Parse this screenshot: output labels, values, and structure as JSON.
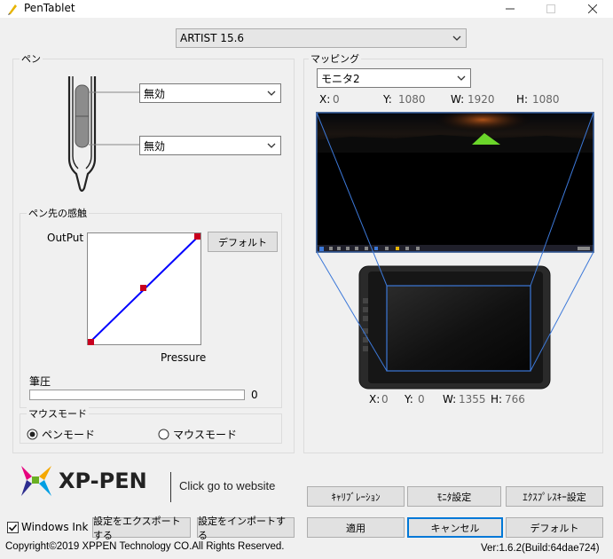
{
  "window": {
    "title": "PenTablet"
  },
  "device_select": {
    "value": "ARTIST 15.6"
  },
  "pen": {
    "group_label": "ペン",
    "upper_button": "無効",
    "lower_button": "無効"
  },
  "pressure_group": {
    "label": "ペン先の感触",
    "output_label": "OutPut",
    "pressure_label": "Pressure",
    "default_button": "デフォルト",
    "hitsuatsu_label": "筆圧",
    "hitsuatsu_value": "0",
    "hitsuatsu_level": 0
  },
  "mouse_mode": {
    "label": "マウスモード",
    "pen_mode": "ペンモード",
    "mouse_mode": "マウスモード",
    "selected": "pen"
  },
  "mapping": {
    "label": "マッピング",
    "monitor_select": "モニタ2",
    "screen": {
      "x_label": "X:",
      "x": "0",
      "y_label": "Y:",
      "y": "1080",
      "w_label": "W:",
      "w": "1920",
      "h_label": "H:",
      "h": "1080"
    },
    "tablet": {
      "x_label": "X:",
      "x": "0",
      "y_label": "Y:",
      "y": "0",
      "w_label": "W:",
      "w": "1355",
      "h_label": "H:",
      "h": "766"
    }
  },
  "brand": {
    "logo_text": "XP-PEN",
    "link_text": "Click go to website"
  },
  "buttons": {
    "calibration": "ｷｬﾘﾌﾞﾚｰｼｮﾝ",
    "monitor_settings": "ﾓﾆﾀ設定",
    "express_keys": "ｴｸｽﾌﾟﾚｽｷｰ設定",
    "apply": "適用",
    "cancel": "キャンセル",
    "default": "デフォルト",
    "export": "設定をエクスポートする",
    "import": "設定をインポートする"
  },
  "windows_ink": {
    "label": "Windows Ink",
    "checked": true
  },
  "footer": {
    "copyright": "Copyright©2019  XPPEN Technology CO.All Rights Reserved.",
    "version": "Ver:1.6.2(Build:64dae724)"
  },
  "colors": {
    "accent": "#0078d7",
    "curve": "#0000ff",
    "curve_point": "#c8001e",
    "map_line": "#3c78d8",
    "tent": "#6bd62a"
  }
}
